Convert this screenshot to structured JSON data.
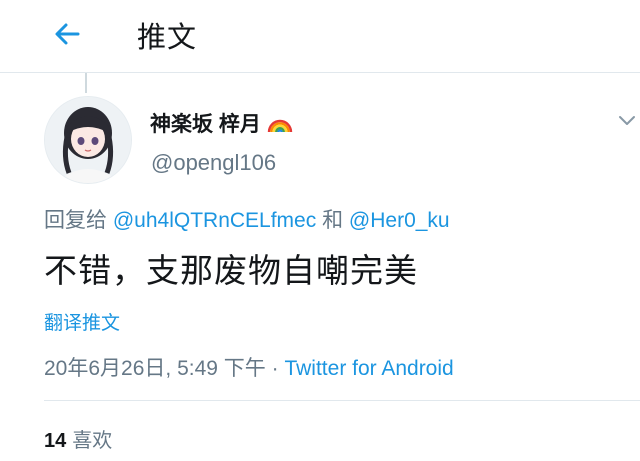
{
  "header": {
    "title": "推文",
    "back_icon": "arrow-left-icon"
  },
  "author": {
    "display_name": "神楽坂 梓月",
    "badge_icon": "rainbow-emoji-icon",
    "handle": "@opengl106"
  },
  "tweet": {
    "reply_prefix": "回复给",
    "reply_to_1": "@uh4lQTRnCELfmec",
    "reply_joiner": "和",
    "reply_to_2": "@Her0_ku",
    "text": "不错，支那废物自嘲完美",
    "translate_label": "翻译推文",
    "timestamp": "20年6月26日, 5:49 下午",
    "separator": "·",
    "source": "Twitter for Android"
  },
  "stats": {
    "likes_count": "14",
    "likes_label": "喜欢"
  },
  "colors": {
    "accent": "#1b95e0",
    "secondary_text": "#657786",
    "primary_text": "#14171a",
    "border": "#e1e8ed"
  }
}
